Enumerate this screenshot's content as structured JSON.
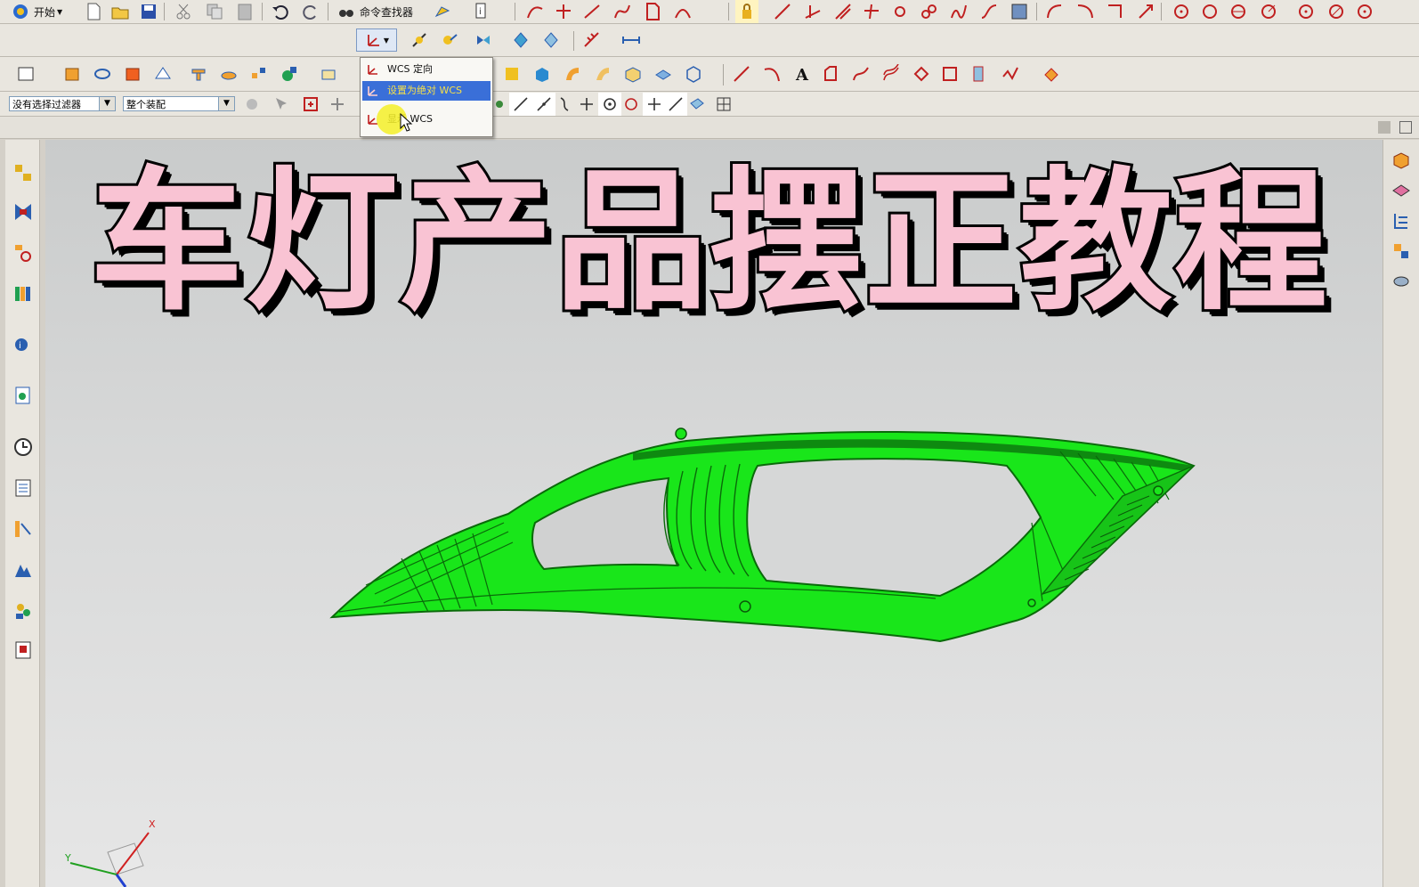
{
  "toolbar1": {
    "start_label": "开始",
    "command_finder_label": "命令查找器"
  },
  "filters": {
    "type_filter": "没有选择过滤器",
    "scope": "整个装配"
  },
  "wcs_menu": {
    "items": [
      {
        "label": "WCS 定向"
      },
      {
        "label": "设置为绝对 WCS",
        "selected": true
      },
      {
        "label": "显示 WCS"
      }
    ]
  },
  "overlay_title": "车灯产品摆正教程",
  "triad": {
    "x_label": "X",
    "y_label": "Y"
  },
  "colors": {
    "part_green": "#19e61a",
    "title_pink": "#f9c3d3",
    "menu_highlight": "#3a6fd8"
  }
}
